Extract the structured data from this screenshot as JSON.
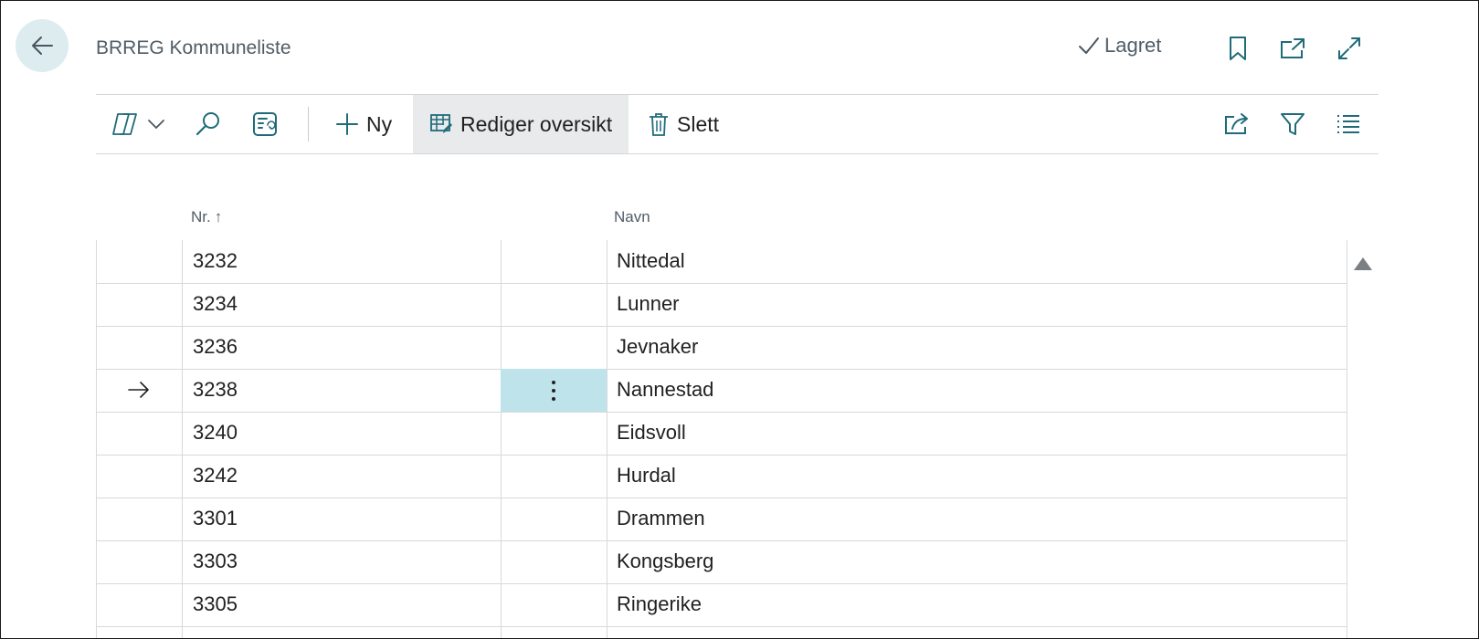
{
  "header": {
    "title": "BRREG Kommuneliste",
    "status": "Lagret",
    "icons": [
      "back-arrow-icon",
      "check-icon",
      "bookmark-icon",
      "open-new-window-icon",
      "expand-icon"
    ]
  },
  "toolbar": {
    "items": [
      {
        "name": "copilot-icon",
        "label": ""
      },
      {
        "name": "search-icon",
        "label": ""
      },
      {
        "name": "analysis-view-icon",
        "label": ""
      },
      {
        "name": "new",
        "label": "Ny"
      },
      {
        "name": "edit-list",
        "label": "Rediger oversikt"
      },
      {
        "name": "delete",
        "label": "Slett"
      }
    ],
    "right_icons": [
      "share-icon",
      "filter-icon",
      "list-view-icon"
    ]
  },
  "table": {
    "columns": [
      "Nr.",
      "Navn"
    ],
    "sort_indicator": "↑",
    "rows": [
      {
        "nr": "3232",
        "navn": "Nittedal"
      },
      {
        "nr": "3234",
        "navn": "Lunner"
      },
      {
        "nr": "3236",
        "navn": "Jevnaker"
      },
      {
        "nr": "3238",
        "navn": "Nannestad",
        "selected": true
      },
      {
        "nr": "3240",
        "navn": "Eidsvoll"
      },
      {
        "nr": "3242",
        "navn": "Hurdal"
      },
      {
        "nr": "3301",
        "navn": "Drammen"
      },
      {
        "nr": "3303",
        "navn": "Kongsberg"
      },
      {
        "nr": "3305",
        "navn": "Ringerike"
      }
    ]
  },
  "colors": {
    "accent": "#1f6b7a",
    "back_button_bg": "#dcecef",
    "selected_cell_bg": "#bfe3ea",
    "active_toolbar_bg": "#e8eaec"
  }
}
